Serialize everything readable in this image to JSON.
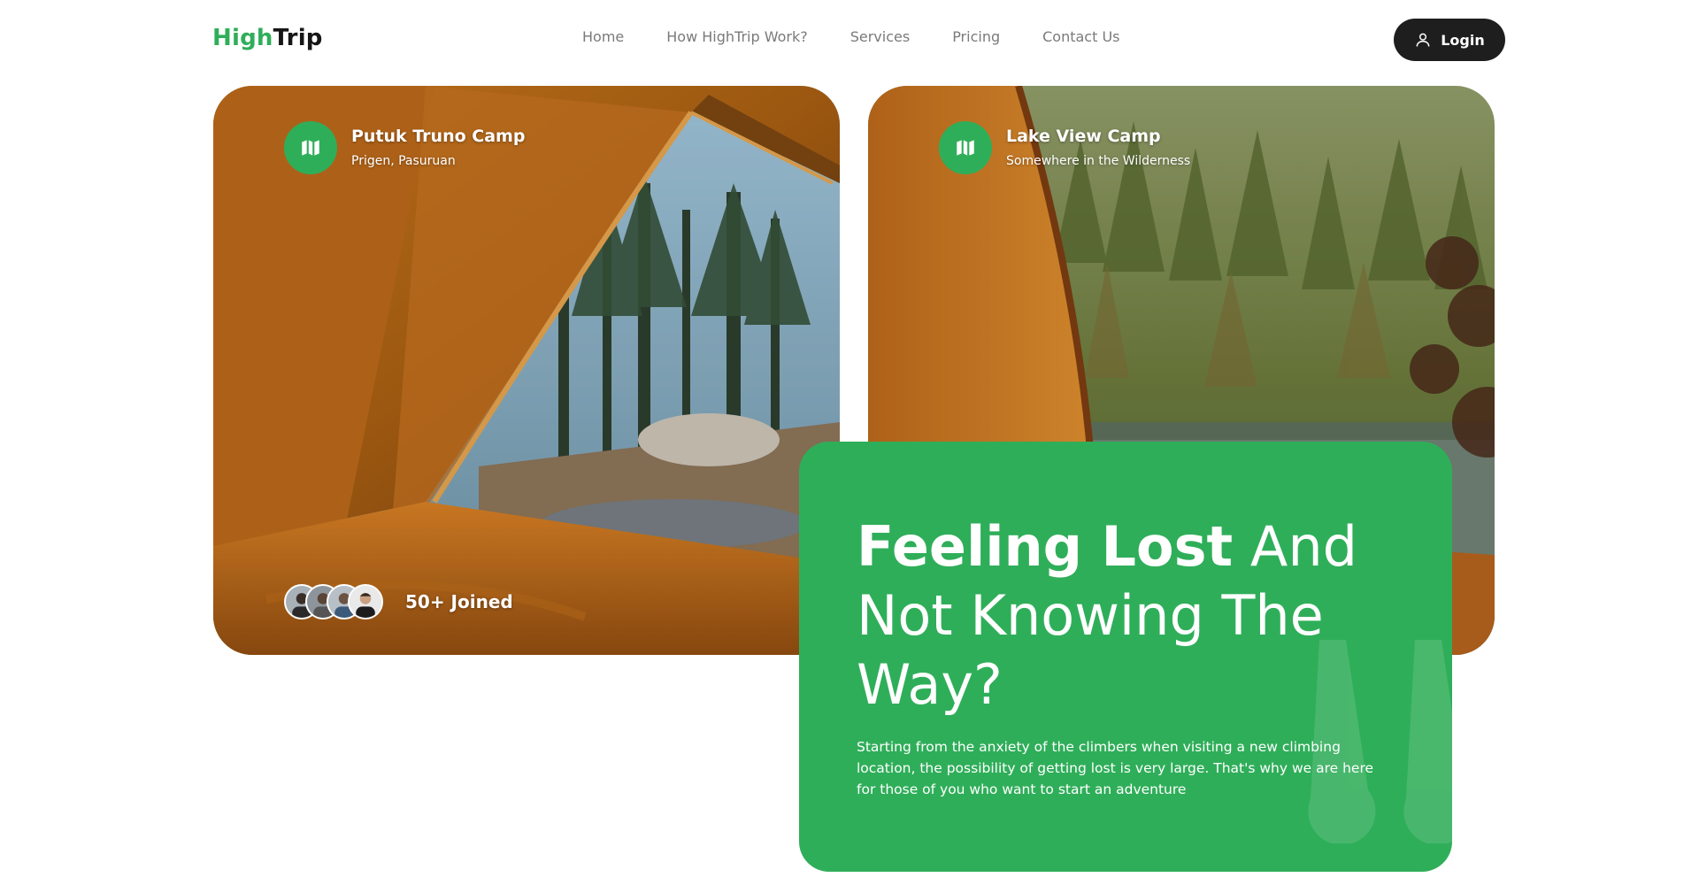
{
  "header": {
    "logo_part1": "High",
    "logo_part2": "Trip",
    "nav": [
      "Home",
      "How HighTrip Work?",
      "Services",
      "Pricing",
      "Contact Us"
    ],
    "login_label": "Login"
  },
  "cards": [
    {
      "title": "Putuk Truno Camp",
      "subtitle": "Prigen, Pasuruan",
      "joined": "50+ Joined"
    },
    {
      "title": "Lake View Camp",
      "subtitle": "Somewhere in the Wilderness"
    }
  ],
  "hero": {
    "headline_bold": "Feeling Lost",
    "headline_rest": " And Not Knowing The Way?",
    "body": "Starting from the anxiety of the climbers when visiting a new climbing location, the possibility of getting lost is very large. That's why we are here for those of you who want to start an adventure"
  },
  "colors": {
    "brand": "#2fae59",
    "dark": "#1e1e1e",
    "nav_text": "#7a7a7a"
  },
  "icons": {
    "login": "user-icon",
    "card_badge": "map-icon"
  }
}
